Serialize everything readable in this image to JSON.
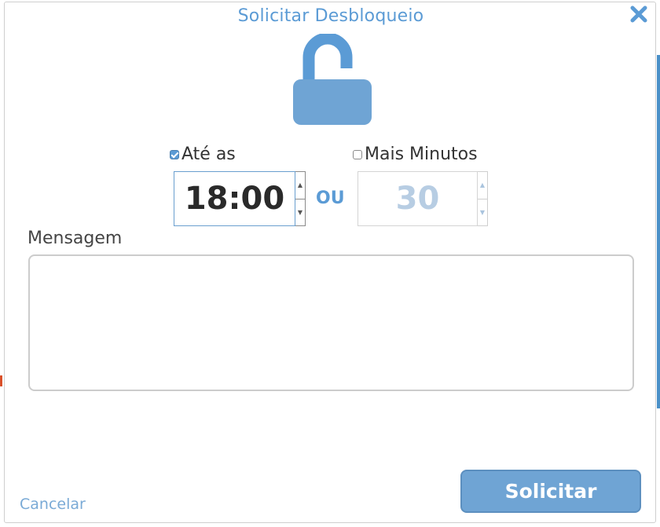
{
  "dialog": {
    "title": "Solicitar Desbloqueio",
    "close_icon": "close-icon",
    "lock_icon": "unlocked-padlock-icon"
  },
  "options": {
    "ate_as": {
      "label": "Até as",
      "checked": true
    },
    "mais_minutos": {
      "label": "Mais Minutos",
      "checked": false
    },
    "separator": "OU"
  },
  "time_spinner": {
    "value": "18:00"
  },
  "minutes_spinner": {
    "value": "30"
  },
  "message": {
    "label": "Mensagem",
    "value": ""
  },
  "actions": {
    "cancel_label": "Cancelar",
    "submit_label": "Solicitar"
  },
  "colors": {
    "accent": "#5b9bd5",
    "button": "#6fa4d4",
    "disabled_text": "#b7cde3"
  }
}
